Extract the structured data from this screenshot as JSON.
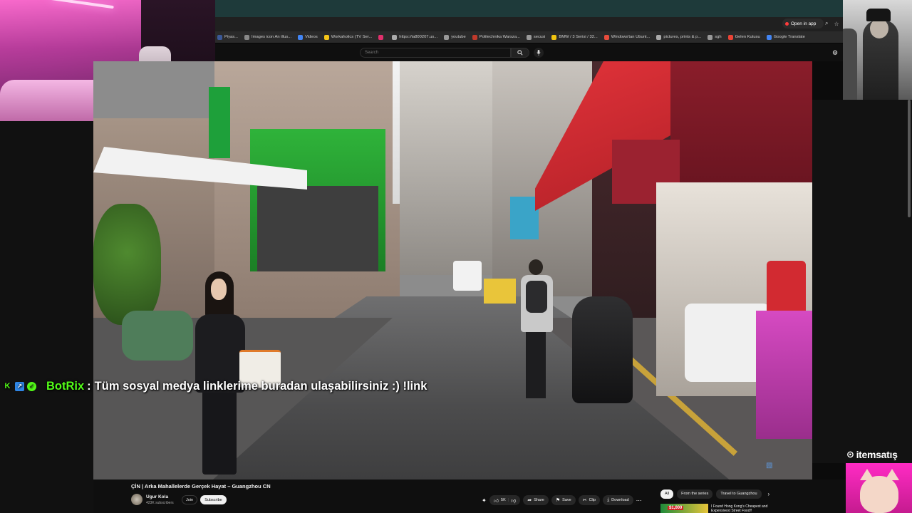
{
  "browser": {
    "open_in_app": "Open in app",
    "bookmarks": [
      {
        "label": "Piyas...",
        "color": "#3b5998"
      },
      {
        "label": "Images icon An illus...",
        "color": "#888888"
      },
      {
        "label": "Videos",
        "color": "#4285f4"
      },
      {
        "label": "Workaholics (TV Ser...",
        "color": "#f5c518"
      },
      {
        "label": "",
        "color": "#e1306c"
      },
      {
        "label": "https://ia800207.us...",
        "color": "#aaaaaa"
      },
      {
        "label": "youtube",
        "color": "#999999"
      },
      {
        "label": "Politechnika Warsza...",
        "color": "#c0392b"
      },
      {
        "label": "secusi",
        "color": "#999999"
      },
      {
        "label": "BMW / 3 Serisi / 32...",
        "color": "#f1c40f"
      },
      {
        "label": "Windows'tan Ubunt...",
        "color": "#e74c3c"
      },
      {
        "label": "pictures, prints & p...",
        "color": "#aaaaaa"
      },
      {
        "label": "sgh",
        "color": "#999999"
      },
      {
        "label": "Gelen Kutusu",
        "color": "#ea4335"
      },
      {
        "label": "Google Translate",
        "color": "#4285f4"
      }
    ]
  },
  "youtube": {
    "search_placeholder": "Search",
    "video_title": "ÇİN | Arka Mahallelerde Gerçek Hayat – Guangzhou CN",
    "channel_name": "Ugur Kola",
    "channel_subs": "423K subscribers",
    "join_label": "Join",
    "subscribe_label": "Subscribe",
    "actions": {
      "like_count": "5K",
      "share": "Share",
      "save": "Save",
      "clip": "Clip",
      "download": "Download"
    },
    "chips": [
      "All",
      "From the series",
      "Travel to Guangzhou"
    ],
    "recommended": {
      "price_tag": "$1,000",
      "title": "I Found Hong Kong's Cheapest and Expensivest Street Food!!"
    }
  },
  "chat": {
    "user": "BotRix",
    "separator": ":",
    "message": "Tüm sosyal medya linklerime buradan ulaşabilirsiniz :) !link"
  },
  "overlay": {
    "sponsor": "itemsatış"
  },
  "colors": {
    "kick_green": "#53fc18",
    "youtube_bg": "#0f0f0f",
    "chat_text": "#ffffff"
  }
}
